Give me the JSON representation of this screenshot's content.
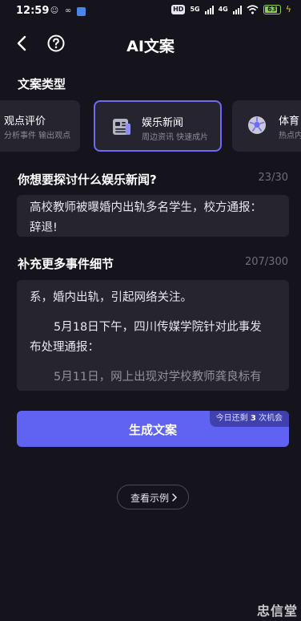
{
  "status_bar": {
    "time": "12:59",
    "hd_tag": "HD",
    "net1": "5G",
    "net2": "4G",
    "battery": "63"
  },
  "nav": {
    "title": "AI文案"
  },
  "article_type": {
    "label": "文案类型",
    "cards": [
      {
        "name": "观点评价",
        "desc": "分析事件 输出观点",
        "selected": false
      },
      {
        "name": "娱乐新闻",
        "desc": "周边资讯 快速成片",
        "selected": true
      },
      {
        "name": "体育",
        "desc": "热点内",
        "selected": false
      }
    ]
  },
  "topic": {
    "label": "你想要探讨什么娱乐新闻?",
    "counter": "23/30",
    "value_line1": "高校教师被曝婚内出轨多名学生，校方通报：",
    "value_line2": "辞退!"
  },
  "details": {
    "label": "补充更多事件细节",
    "counter": "207/300",
    "line1": "系，婚内出轨，引起网络关注。",
    "line2": "5月18日下午，四川传媒学院针对此事发",
    "line3": "布处理通报：",
    "line4": "5月11日，网上出现对学校教师龚良标有"
  },
  "generate": {
    "label": "生成文案",
    "badge_prefix": "今日还剩",
    "badge_count": "3",
    "badge_suffix": "次机会"
  },
  "example": {
    "label": "查看示例"
  },
  "watermark": "忠信堂"
}
